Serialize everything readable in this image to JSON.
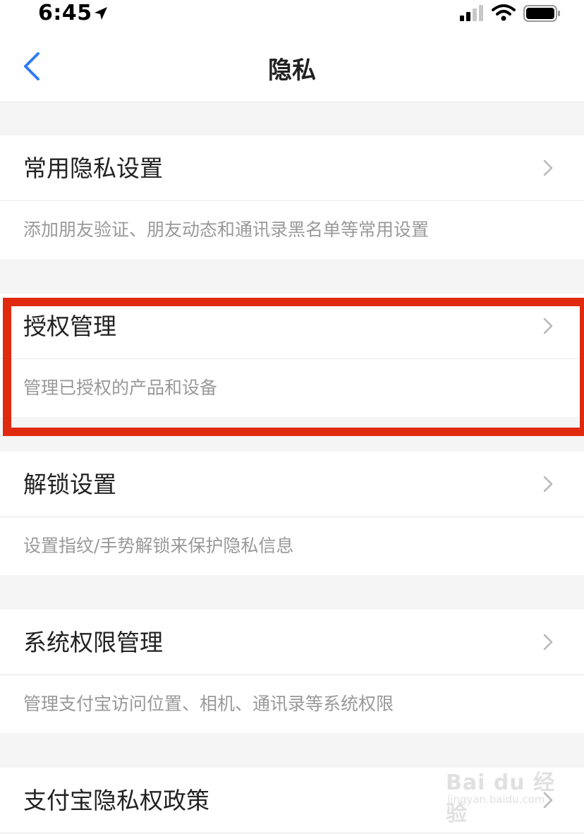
{
  "status_bar": {
    "time": "6:45",
    "icons": [
      "location-arrow-icon",
      "signal-icon",
      "wifi-icon",
      "battery-icon"
    ]
  },
  "nav": {
    "title": "隐私",
    "back_icon": "chevron-left-icon"
  },
  "sections": [
    {
      "title": "常用隐私设置",
      "description": "添加朋友验证、朋友动态和通讯录黑名单等常用设置"
    },
    {
      "title": "授权管理",
      "description": "管理已授权的产品和设备",
      "highlighted": true
    },
    {
      "title": "解锁设置",
      "description": "设置指纹/手势解锁来保护隐私信息"
    },
    {
      "title": "系统权限管理",
      "description": "管理支付宝访问位置、相机、通讯录等系统权限"
    },
    {
      "title": "支付宝隐私权政策"
    }
  ],
  "watermark": {
    "brand": "Bai du 经验",
    "url": "jingyan.baidu.com"
  },
  "colors": {
    "accent": "#2f7bf5",
    "highlight": "#e02a10",
    "background": "#f5f5f5"
  }
}
